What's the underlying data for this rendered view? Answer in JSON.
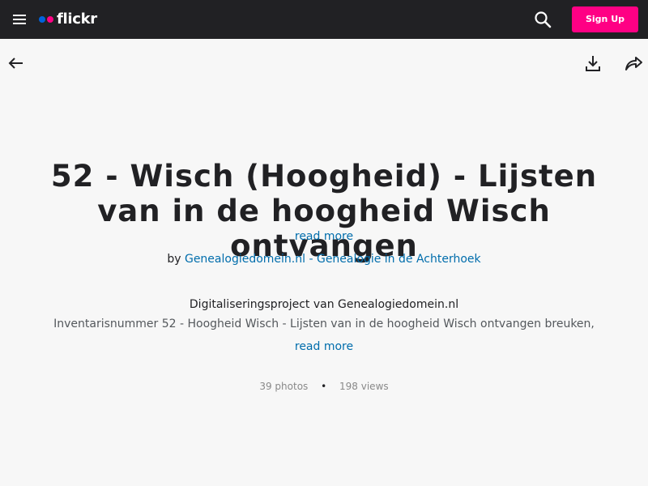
{
  "header": {
    "logo_text": "flickr",
    "signup_label": "Sign Up",
    "colors": {
      "bar": "#212124",
      "dot_blue": "#0063dc",
      "dot_pink": "#ff0084",
      "signup": "#ff0084"
    },
    "icons": [
      "hamburger-menu-icon",
      "search-icon"
    ]
  },
  "actions": {
    "icons": [
      "back-arrow-icon",
      "download-icon",
      "share-icon"
    ]
  },
  "album": {
    "title": "52 - Wisch (Hoogheid) - Lijsten van in de hoogheid Wisch ontvangen",
    "read_more_title": "read more",
    "by_prefix": "by",
    "owner": "Genealogiedomein.nl - Genealogie in de Achterhoek",
    "description_line1": "Digitaliseringsproject van Genealogiedomein.nl",
    "description_line2": "Inventarisnummer 52 - Hoogheid Wisch - Lijsten van in de hoogheid Wisch ontvangen breuken,",
    "read_more_description": "read more",
    "photos": "39 photos",
    "separator": "•",
    "views": "198 views",
    "link_color": "#006dac"
  }
}
